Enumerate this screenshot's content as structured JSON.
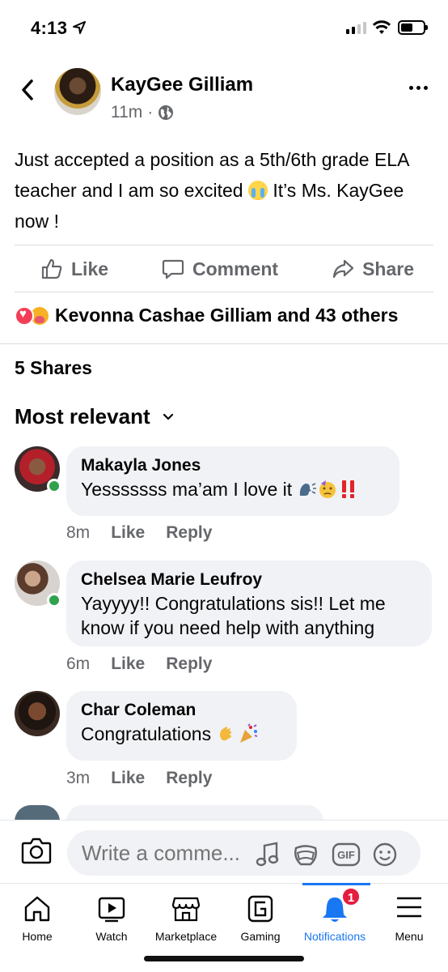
{
  "status_bar": {
    "time": "4:13"
  },
  "post": {
    "author": "KayGee Gilliam",
    "time": "11m",
    "separator": "·",
    "text_before_emoji": "Just accepted a position as a 5th/6th grade ELA teacher and I am so excited ",
    "text_after_emoji": " It’s Ms. KayGee now !"
  },
  "actions": {
    "like": "Like",
    "comment": "Comment",
    "share": "Share"
  },
  "reactions": {
    "text": "Kevonna Cashae Gilliam and 43 others"
  },
  "shares": {
    "text": "5 Shares"
  },
  "sort": {
    "label": "Most relevant"
  },
  "comments": [
    {
      "name": "Makayla Jones",
      "text": "Yesssssss ma’am I love it",
      "time": "8m",
      "like": "Like",
      "reply": "Reply",
      "online": true
    },
    {
      "name": "Chelsea Marie Leufroy",
      "text": "Yayyyy!! Congratulations sis!! Let me know if you need help with anything",
      "time": "6m",
      "like": "Like",
      "reply": "Reply",
      "online": true
    },
    {
      "name": "Char Coleman",
      "text": "Congratulations",
      "time": "3m",
      "like": "Like",
      "reply": "Reply",
      "online": false
    }
  ],
  "composer": {
    "placeholder": "Write a comme..."
  },
  "tabs": [
    {
      "label": "Home",
      "icon": "home-icon"
    },
    {
      "label": "Watch",
      "icon": "watch-icon"
    },
    {
      "label": "Marketplace",
      "icon": "marketplace-icon"
    },
    {
      "label": "Gaming",
      "icon": "gaming-icon"
    },
    {
      "label": "Notifications",
      "icon": "bell-icon",
      "badge": "1",
      "active": true
    },
    {
      "label": "Menu",
      "icon": "menu-icon"
    }
  ],
  "colors": {
    "accent": "#1877f2",
    "secondary_text": "#65676b",
    "bubble": "#f0f2f5",
    "online": "#31a24c",
    "badge": "#e41e3f"
  }
}
